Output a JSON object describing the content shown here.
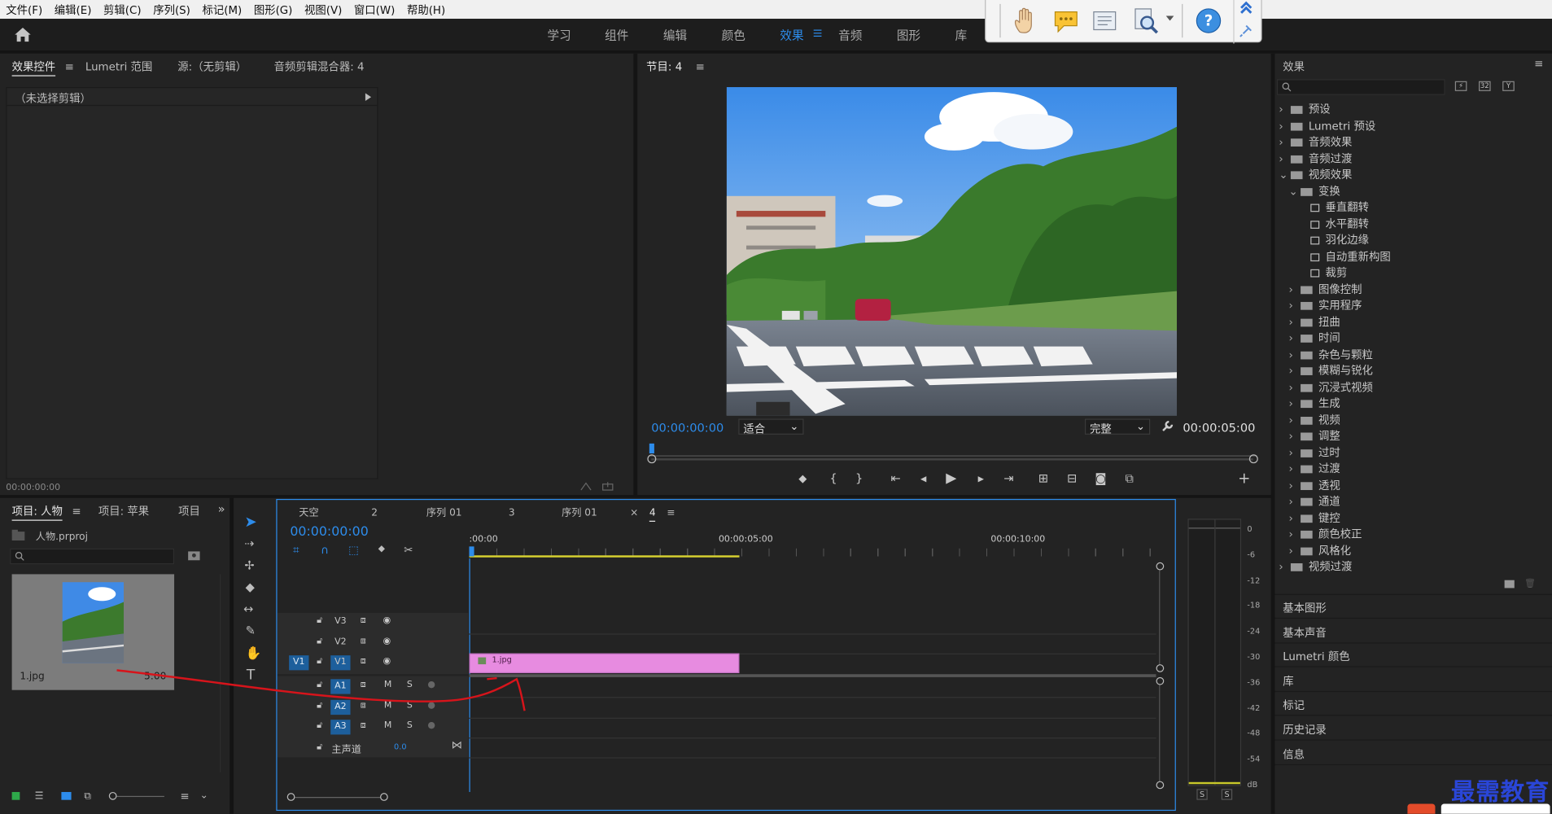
{
  "menu": [
    "文件(F)",
    "编辑(E)",
    "剪辑(C)",
    "序列(S)",
    "标记(M)",
    "图形(G)",
    "视图(V)",
    "窗口(W)",
    "帮助(H)"
  ],
  "workspaces": [
    "学习",
    "组件",
    "编辑",
    "颜色",
    "效果",
    "音频",
    "图形",
    "库"
  ],
  "active_workspace": "效果",
  "effect_controls": {
    "tabs": [
      "效果控件",
      "Lumetri 范围",
      "源:（无剪辑）",
      "音频剪辑混合器: 4"
    ],
    "no_clip": "（未选择剪辑）",
    "timecode": "00:00:00:00"
  },
  "program": {
    "title": "节目: 4",
    "timecode_current": "00:00:00:00",
    "fit": "适合",
    "quality": "完整",
    "timecode_duration": "00:00:05:00"
  },
  "project": {
    "tabs": [
      "项目: 人物",
      "项目: 苹果",
      "项目"
    ],
    "file": "人物.prproj",
    "clip_name": "1.jpg",
    "clip_duration": "5:00"
  },
  "timeline": {
    "tabs": [
      "天空",
      "2",
      "序列 01",
      "3",
      "序列 01",
      "4"
    ],
    "timecode": "00:00:00:00",
    "ruler": [
      ":00:00",
      "00:00:05:00",
      "00:00:10:00"
    ],
    "video_tracks": [
      "V3",
      "V2",
      "V1"
    ],
    "source_patch": "V1",
    "audio_tracks": [
      "A1",
      "A2",
      "A3"
    ],
    "master_label": "主声道",
    "master_value": "0.0",
    "clip_label": "1.jpg",
    "mute": "M",
    "solo": "S"
  },
  "meter": {
    "scale": [
      "0",
      "-6",
      "-12",
      "-18",
      "-24",
      "-30",
      "-36",
      "-42",
      "-48",
      "-54",
      "dB"
    ],
    "solo": [
      "S",
      "S"
    ]
  },
  "effects_panel": {
    "title": "效果",
    "tree": [
      {
        "label": "预设",
        "level": 0,
        "state": "closed"
      },
      {
        "label": "Lumetri 预设",
        "level": 0,
        "state": "closed"
      },
      {
        "label": "音频效果",
        "level": 0,
        "state": "closed"
      },
      {
        "label": "音频过渡",
        "level": 0,
        "state": "closed"
      },
      {
        "label": "视频效果",
        "level": 0,
        "state": "open"
      },
      {
        "label": "变换",
        "level": 1,
        "state": "open"
      },
      {
        "label": "垂直翻转",
        "level": 2,
        "state": "leaf"
      },
      {
        "label": "水平翻转",
        "level": 2,
        "state": "leaf"
      },
      {
        "label": "羽化边缘",
        "level": 2,
        "state": "leaf"
      },
      {
        "label": "自动重新构图",
        "level": 2,
        "state": "leaf"
      },
      {
        "label": "裁剪",
        "level": 2,
        "state": "leaf"
      },
      {
        "label": "图像控制",
        "level": 1,
        "state": "closed"
      },
      {
        "label": "实用程序",
        "level": 1,
        "state": "closed"
      },
      {
        "label": "扭曲",
        "level": 1,
        "state": "closed"
      },
      {
        "label": "时间",
        "level": 1,
        "state": "closed"
      },
      {
        "label": "杂色与颗粒",
        "level": 1,
        "state": "closed"
      },
      {
        "label": "模糊与锐化",
        "level": 1,
        "state": "closed"
      },
      {
        "label": "沉浸式视频",
        "level": 1,
        "state": "closed"
      },
      {
        "label": "生成",
        "level": 1,
        "state": "closed"
      },
      {
        "label": "视频",
        "level": 1,
        "state": "closed"
      },
      {
        "label": "调整",
        "level": 1,
        "state": "closed"
      },
      {
        "label": "过时",
        "level": 1,
        "state": "closed"
      },
      {
        "label": "过渡",
        "level": 1,
        "state": "closed"
      },
      {
        "label": "透视",
        "level": 1,
        "state": "closed"
      },
      {
        "label": "通道",
        "level": 1,
        "state": "closed"
      },
      {
        "label": "键控",
        "level": 1,
        "state": "closed"
      },
      {
        "label": "颜色校正",
        "level": 1,
        "state": "closed"
      },
      {
        "label": "风格化",
        "level": 1,
        "state": "closed"
      },
      {
        "label": "视频过渡",
        "level": 0,
        "state": "closed"
      }
    ],
    "sections": [
      "基本图形",
      "基本声音",
      "Lumetri 颜色",
      "库",
      "标记",
      "历史记录",
      "信息"
    ]
  },
  "watermark": "最需教育",
  "colors": {
    "accent": "#2d8ceb",
    "clip": "#e78be0",
    "annotation": "#d7141b"
  }
}
